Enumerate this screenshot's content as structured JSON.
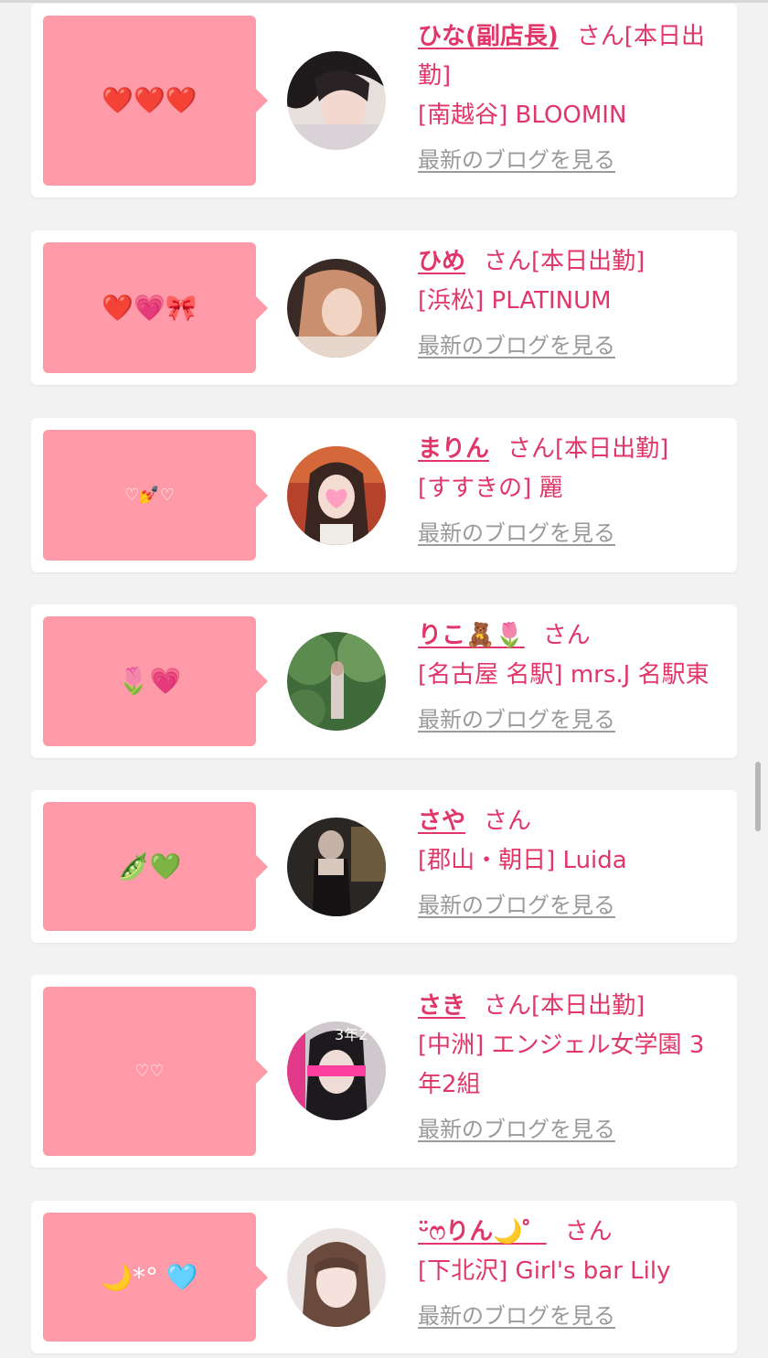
{
  "blog_link_label": "最新のブログを見る",
  "san": "さん",
  "cards": [
    {
      "name": "ひな(副店長)",
      "status": "[本日出勤]",
      "shop": "[南越谷] BLOOMIN",
      "emoji": "❤️❤️❤️",
      "avatar_desc": "photo-woman-dark-hair"
    },
    {
      "name": "ひめ",
      "status": "[本日出勤]",
      "shop": "[浜松] PLATINUM",
      "emoji": "❤️💗🎀",
      "avatar_desc": "photo-woman-light-hair"
    },
    {
      "name": "まりん",
      "status": "[本日出勤]",
      "shop": "[すすきの] 麗",
      "emoji": "♡💅♡",
      "avatar_desc": "photo-woman-heart-face"
    },
    {
      "name": "りこ🧸🌷",
      "status": "",
      "shop": "[名古屋 名駅] mrs.J 名駅東",
      "emoji": "🌷💗",
      "avatar_desc": "photo-woman-garden"
    },
    {
      "name": "さや",
      "status": "",
      "shop": "[郡山・朝日] Luida",
      "emoji": "🫛💚",
      "avatar_desc": "photo-woman-night"
    },
    {
      "name": "さき",
      "status": "[本日出勤]",
      "shop": "[中洲] エンジェル女学園 3年2組",
      "emoji": "♡♡",
      "avatar_desc": "photo-poster-3年2組"
    },
    {
      "name": "ᵕ̈ෆりん🌙゜",
      "status": "",
      "shop": "[下北沢] Girl's bar Lily",
      "emoji": "🌙*° 🩵",
      "avatar_desc": "photo-woman-portrait"
    }
  ],
  "avatar_poster_text": "3年2",
  "colors": {
    "accent": "#e0366a",
    "bubble": "#ff9aa8",
    "link_gray": "#9a9a9a",
    "background": "#f2f2f2"
  }
}
